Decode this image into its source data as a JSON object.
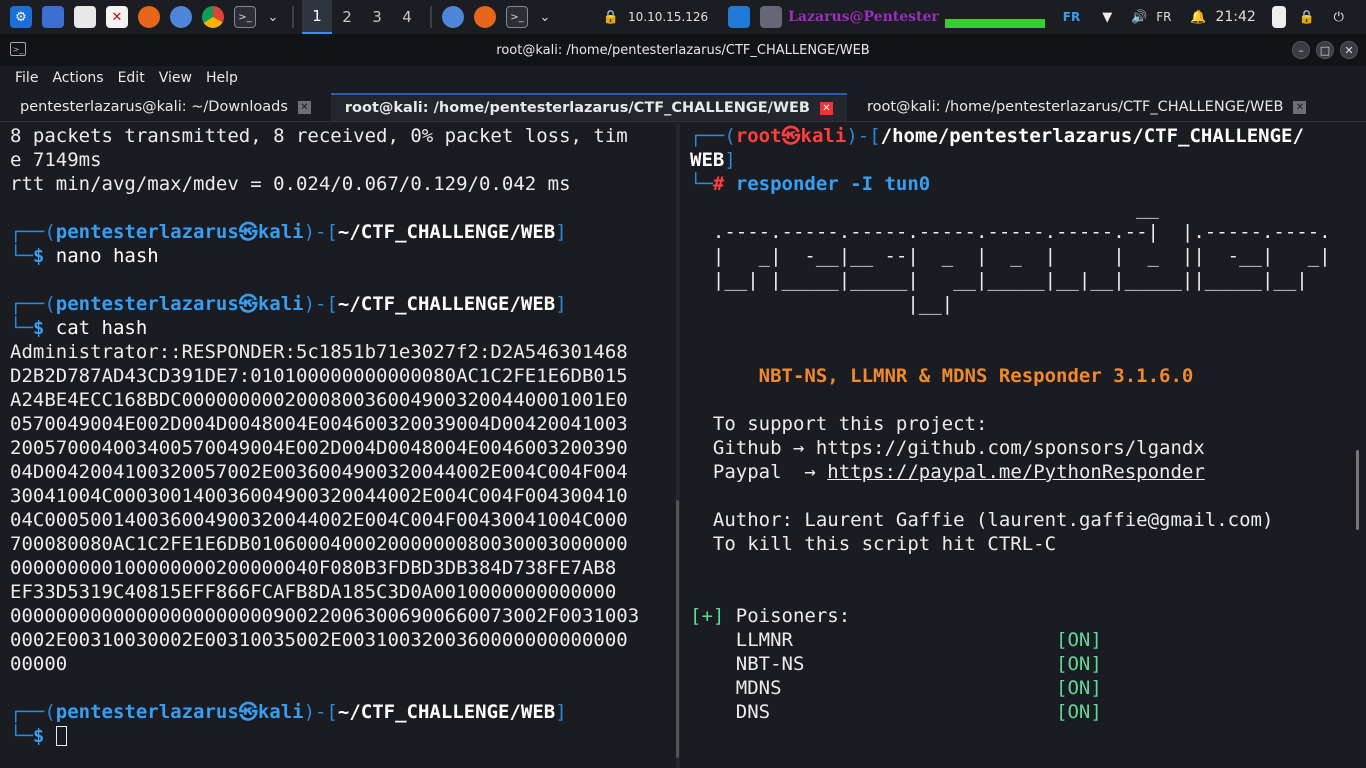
{
  "taskbar": {
    "workspaces": [
      "1",
      "2",
      "3",
      "4"
    ],
    "ip": "10.10.15.126",
    "user_label": "Lazarus@Pentester",
    "keyboard_layout": "FR",
    "language": "FR",
    "clock": "21:42"
  },
  "window": {
    "title": "root@kali: /home/pentesterlazarus/CTF_CHALLENGE/WEB",
    "menu": [
      "File",
      "Actions",
      "Edit",
      "View",
      "Help"
    ],
    "tabs": [
      {
        "label": "pentesterlazarus@kali: ~/Downloads",
        "active": false
      },
      {
        "label": "root@kali: /home/pentesterlazarus/CTF_CHALLENGE/WEB",
        "active": true
      },
      {
        "label": "root@kali: /home/pentesterlazarus/CTF_CHALLENGE/WEB",
        "active": false
      }
    ]
  },
  "left_terminal": {
    "ping_line1": "8 packets transmitted, 8 received, 0% packet loss, tim",
    "ping_line2": "e 7149ms",
    "rtt_line": "rtt min/avg/max/mdev = 0.024/0.067/0.129/0.042 ms",
    "user": "pentesterlazarus",
    "host": "kali",
    "cwd": "~/CTF_CHALLENGE/WEB",
    "cmd1": "nano hash",
    "cmd2": "cat hash",
    "hash_lines": [
      "Administrator::RESPONDER:5c1851b71e3027f2:D2A546301468",
      "D2B2D787AD43CD391DE7:010100000000000080AC1C2FE1E6DB015",
      "A24BE4ECC168BDC000000000200080036004900320044000100 1E0",
      "0570049004E002D004D0048004E004600320039004D00420041003",
      "200570004003400570049004E002D004D0048004E0046003200390",
      "04D004200410032005700 2E003600490032004400 2E004C004F004",
      "30041004C0003001400360049003200440 02E004C004F004300410",
      "04C000500140036004900320044002E004C004F00430041004C000",
      "700080080AC1C2FE1E6DB010600040002000000080030003000000",
      "000000000100000000200000040F080B3FDBD3DB384D738FE7AB8",
      "EF33D5319C40815EFF866FCAFB8DA185C3D0A0010000000000000",
      "00000000000000000000000900220063006900660073002F0031003",
      "0002E00310030002E00310035002E0031003200360000000000000",
      "00000"
    ]
  },
  "right_terminal": {
    "prompt_user": "root",
    "prompt_host": "kali",
    "prompt_dir_line1": "/home/pentesterlazarus/CTF_CHALLENGE/",
    "prompt_dir_line2": "WEB",
    "command": "responder -I tun0",
    "banner": [
      "                                       __",
      "  .----.-----.-----.-----.-----.-----.--|  |.-----.----.",
      "  |   _|  -__|__ --|  _  |  _  |     |  _  ||  -__|   _|",
      "  |__| |_____|_____|   __|_____|__|__|_____||_____|__|",
      "                   |__|"
    ],
    "version_line": "NBT-NS, LLMNR & MDNS Responder 3.1.6.0",
    "support_header": "To support this project:",
    "github_label": "Github",
    "github_url": "https://github.com/sponsors/lgandx",
    "paypal_label": "Paypal",
    "paypal_url": "https://paypal.me/PythonResponder",
    "author_line": "Author: Laurent Gaffie (laurent.gaffie@gmail.com)",
    "kill_line": "To kill this script hit CTRL-C",
    "poisoners_marker": "[+]",
    "poisoners_header": "Poisoners:",
    "poisoners": [
      {
        "name": "LLMNR",
        "status": "[ON]"
      },
      {
        "name": "NBT-NS",
        "status": "[ON]"
      },
      {
        "name": "MDNS",
        "status": "[ON]"
      },
      {
        "name": "DNS",
        "status": "[ON]"
      }
    ]
  },
  "colors": {
    "accent_blue": "#3a9ef0",
    "root_red": "#ff3f3f",
    "banner_orange": "#f08a2a",
    "status_green": "#5fd79b"
  }
}
